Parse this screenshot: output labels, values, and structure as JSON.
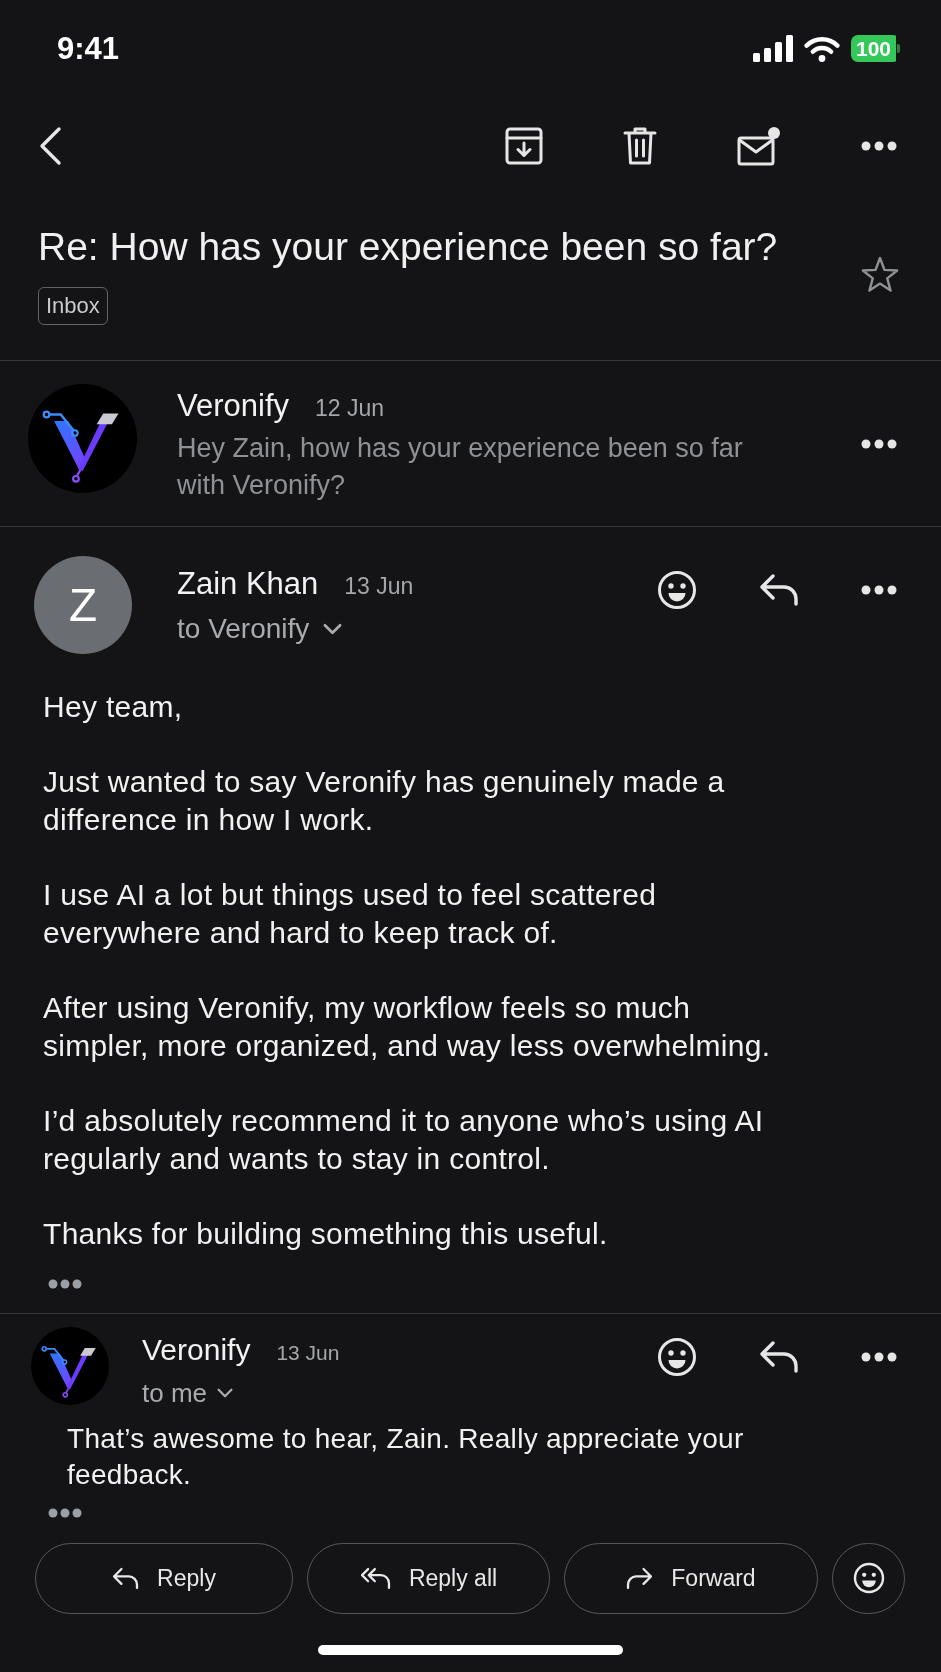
{
  "status_bar": {
    "time": "9:41",
    "battery": "100"
  },
  "subject": "Re: How has your experience been so far?",
  "starred": false,
  "labels": [
    "Inbox"
  ],
  "messages": [
    {
      "kind": "collapsed",
      "sender": "Veronify",
      "avatar": {
        "kind": "logo"
      },
      "date": "12 Jun",
      "snippet": "Hey Zain, how has your experience been so far with Veronify?"
    },
    {
      "kind": "expanded",
      "sender": "Zain Khan",
      "avatar": {
        "kind": "initial",
        "initial": "Z"
      },
      "date": "13 Jun",
      "recipient": "to Veronify",
      "body": [
        "Hey team,",
        "Just wanted to say Veronify has genuinely made a difference in how I work.",
        "I use AI a lot but things used to feel scattered everywhere and hard to keep track of.",
        "After using Veronify, my workflow feels so much simpler, more organized, and way less overwhelming.",
        "I’d absolutely recommend it to anyone who’s using AI regularly and wants to stay in control.",
        "Thanks for building something this useful."
      ]
    },
    {
      "kind": "compact",
      "sender": "Veronify",
      "avatar": {
        "kind": "logo"
      },
      "date": "13 Jun",
      "recipient": "to me",
      "body": [
        "That’s awesome to hear, Zain. Really appreciate your feedback."
      ]
    }
  ],
  "actions": [
    {
      "kind": "reply",
      "label": "Reply"
    },
    {
      "kind": "reply_all",
      "label": "Reply all"
    },
    {
      "kind": "forward",
      "label": "Forward"
    }
  ]
}
